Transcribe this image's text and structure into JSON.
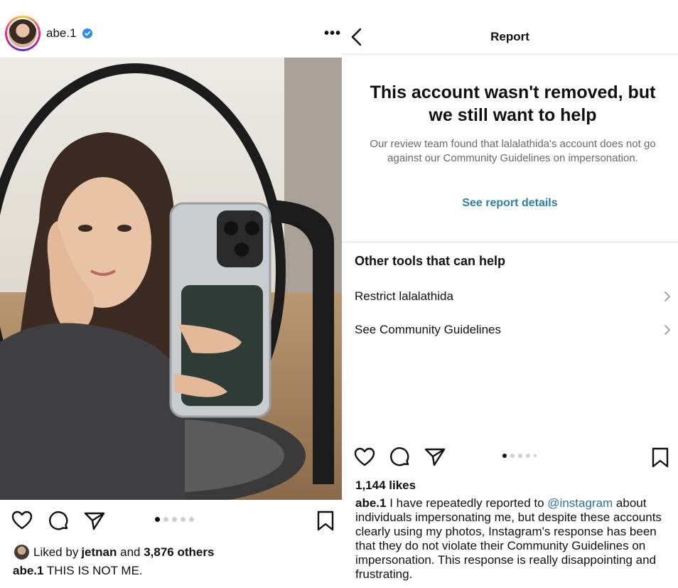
{
  "colors": {
    "accent_link": "#2a7fa8",
    "mention": "#2e6f9f",
    "verified": "#2d8cf0",
    "subtext": "#6b6b6b"
  },
  "left_post": {
    "username": "abe.1",
    "more_label": "•••",
    "liked_by_prefix": "Liked by ",
    "liked_by_user": "jetnan",
    "liked_by_middle": " and ",
    "liked_by_others": "3,876 others",
    "caption_user": "abe.1",
    "caption_text": " THIS IS NOT ME.",
    "carousel": {
      "count": 5,
      "active_index": 0
    },
    "icons": [
      "heart-icon",
      "comment-icon",
      "share-icon",
      "bookmark-icon",
      "verified-badge-icon",
      "more-icon"
    ]
  },
  "report": {
    "header_title": "Report",
    "headline": "This account wasn't removed, but we still want to help",
    "body": "Our review team found that lalalathida's account does not go against our Community Guidelines on impersonation.",
    "link": "See report details",
    "tools_title": "Other tools that can help",
    "tools": [
      {
        "label": "Restrict lalalathida"
      },
      {
        "label": "See Community Guidelines"
      }
    ]
  },
  "right_post": {
    "likes": "1,144 likes",
    "caption_user": "abe.1",
    "caption_pre": " I have repeatedly reported to ",
    "caption_mention": "@instagram",
    "caption_post": " about individuals impersonating me, but despite these accounts clearly using my photos, Instagram's response has been that they do not violate their Community Guidelines on impersonation. This response is really disappointing and frustrating.",
    "carousel": {
      "count": 5,
      "active_index": 0
    }
  }
}
